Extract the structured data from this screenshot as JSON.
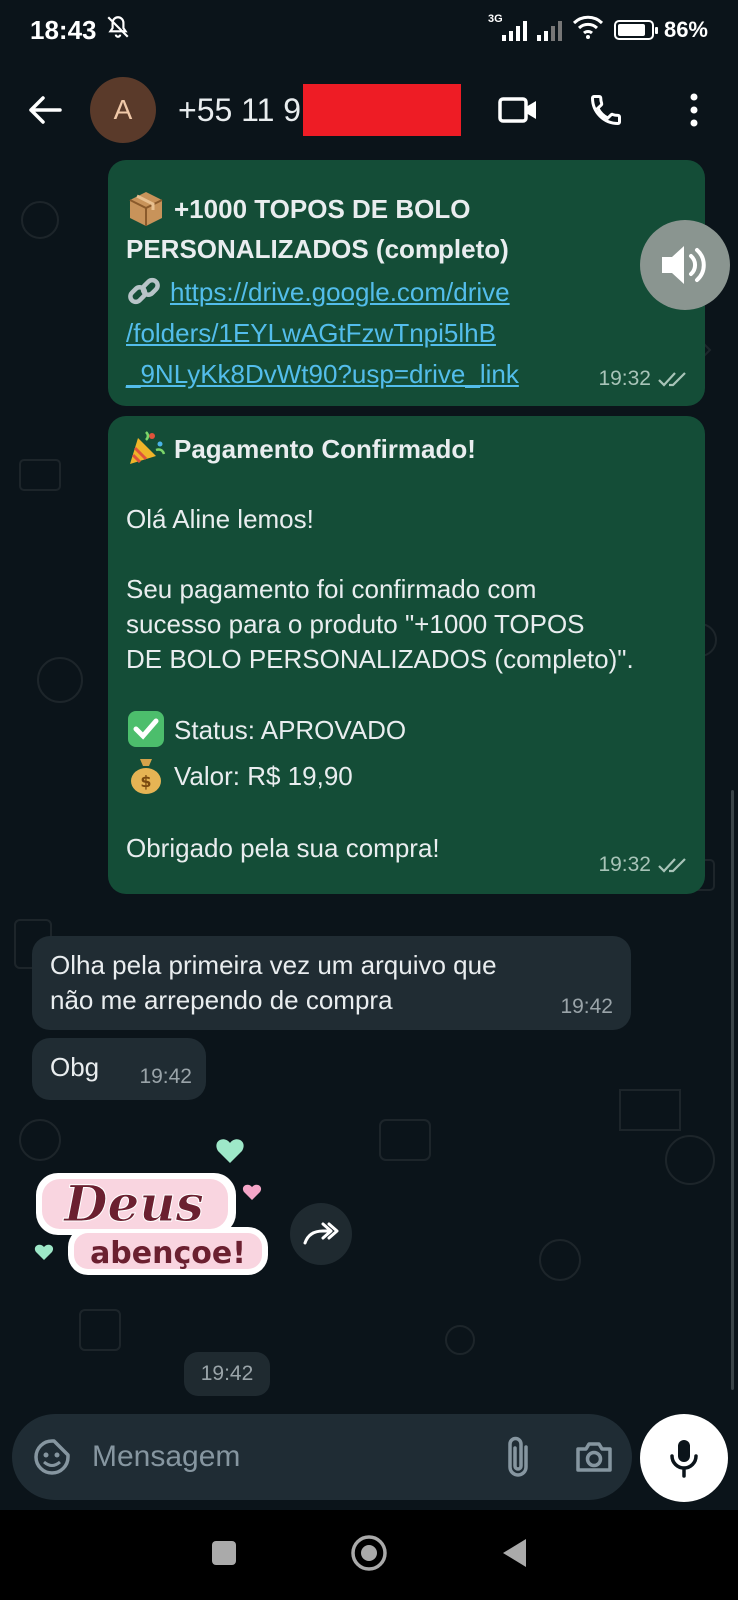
{
  "status_bar": {
    "time": "18:43",
    "network_type": "3G",
    "battery": "86%",
    "battery_level": 0.86
  },
  "header": {
    "avatar_letter": "A",
    "contact": "+55 11 9"
  },
  "messages": {
    "m1": {
      "title_line1": "+1000 TOPOS DE BOLO",
      "title_line2": "PERSONALIZADOS (completo)",
      "link_line1": "https://drive.google.com/drive",
      "link_line2": "/folders/1EYLwAGtFzwTnpi5lhB",
      "link_line3": "_9NLyKk8DvWt90?usp=drive_link",
      "time": "19:32"
    },
    "m2": {
      "title": "Pagamento Confirmado!",
      "greeting": "Olá Aline lemos!",
      "body_line1": "Seu pagamento foi confirmado com",
      "body_line2": "sucesso para o produto \"+1000 TOPOS",
      "body_line3": "DE BOLO PERSONALIZADOS (completo)\".",
      "status": "Status: APROVADO",
      "value": "Valor: R$ 19,90",
      "thanks": "Obrigado pela sua compra!",
      "time": "19:32"
    },
    "m3": {
      "line1": "Olha pela primeira vez um arquivo que",
      "line2": "não me arrependo de compra",
      "time": "19:42"
    },
    "m4": {
      "text": "Obg",
      "time": "19:42"
    },
    "sticker": {
      "line1": "Deus",
      "line2": "abençoe!",
      "time": "19:42"
    }
  },
  "composer": {
    "placeholder": "Mensagem"
  },
  "colors": {
    "background": "#0b141a",
    "outgoing_bubble": "#144d37",
    "incoming_bubble": "#202c33",
    "link": "#53bdeb",
    "redaction": "#ee1c25"
  }
}
